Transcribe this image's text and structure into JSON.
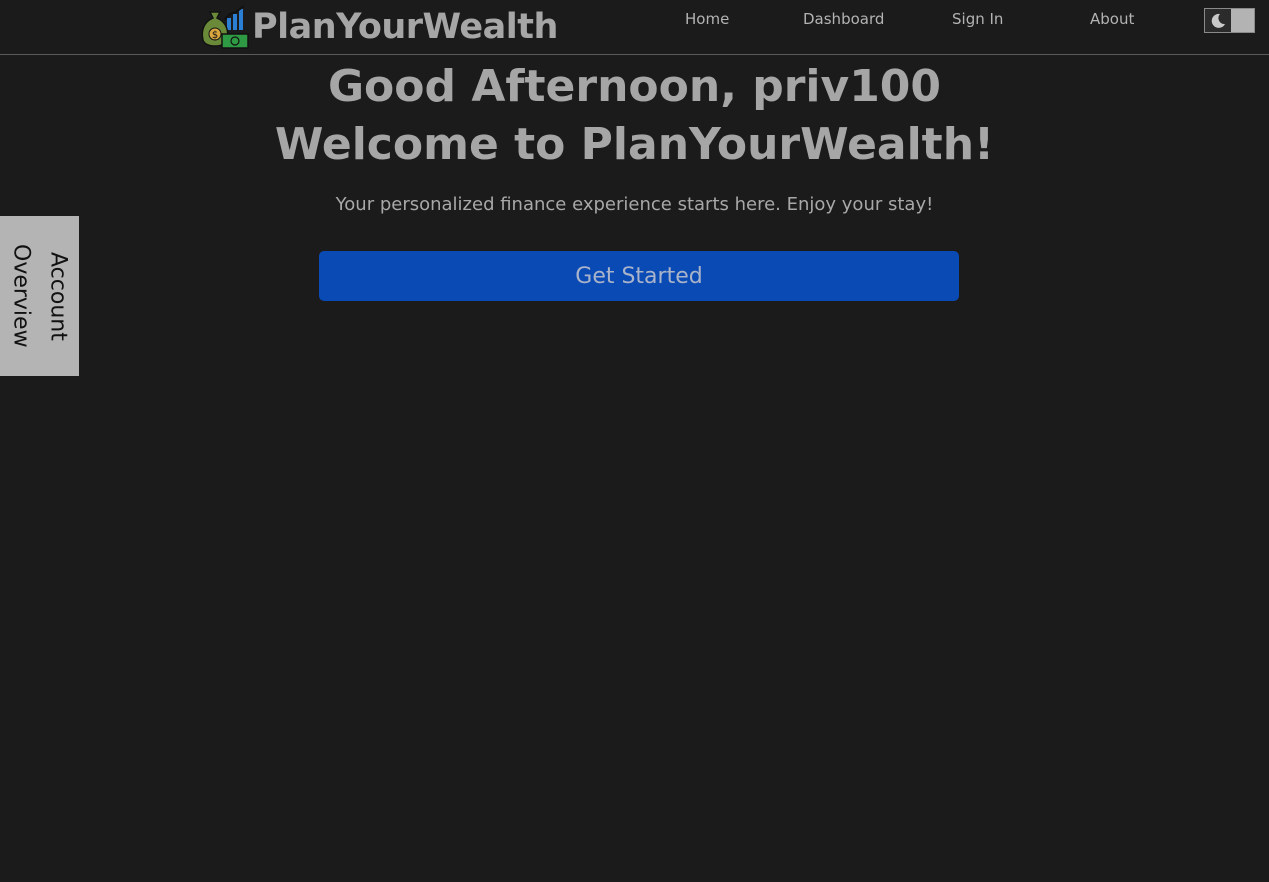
{
  "brand": {
    "name": "PlanYourWealth",
    "logo_icon": "money-bag-chart-icon"
  },
  "nav": {
    "items": [
      {
        "label": "Home"
      },
      {
        "label": "Dashboard"
      },
      {
        "label": "Sign In"
      },
      {
        "label": "About"
      }
    ],
    "theme_toggle_icon": "moon-icon"
  },
  "side_tab": {
    "label": "Account\nOverview"
  },
  "hero": {
    "greeting": "Good Afternoon, priv100",
    "welcome": "Welcome to PlanYourWealth!",
    "tagline": "Your personalized finance experience starts here. Enjoy your stay!",
    "cta_label": "Get Started"
  },
  "colors": {
    "background": "#1b1b1b",
    "accent_corner": "#b85a1c",
    "cta_background": "#0a4ab5",
    "side_tab_background": "#b4b4b4"
  }
}
